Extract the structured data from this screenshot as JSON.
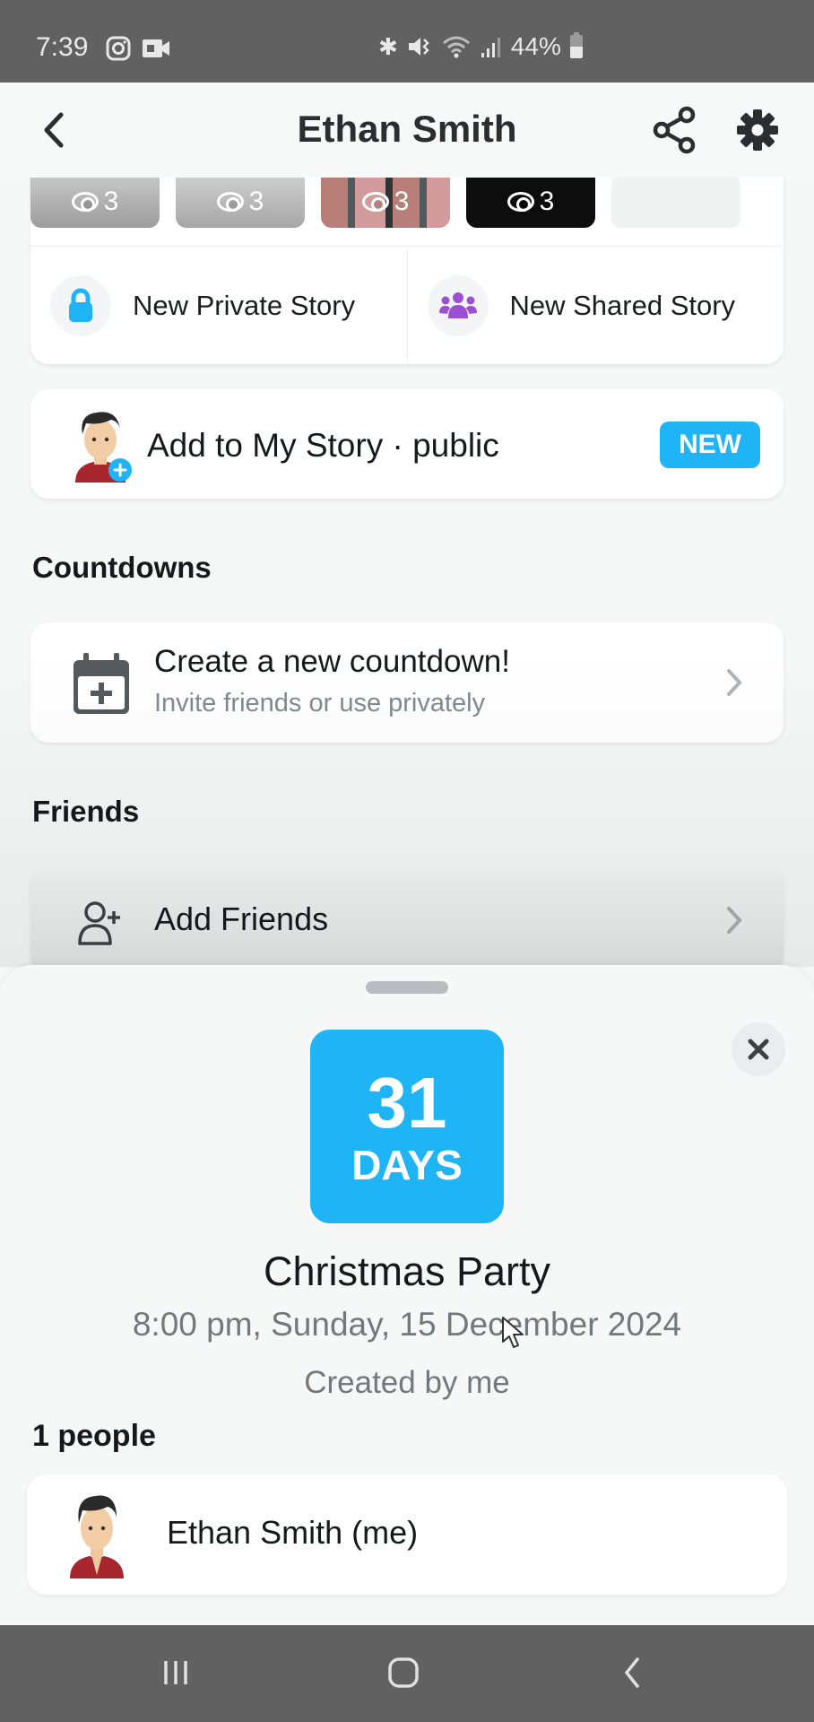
{
  "status_bar": {
    "time": "7:39",
    "left_icons": [
      "instagram-icon",
      "video-camera-icon"
    ],
    "right_icons": [
      "bluetooth-icon",
      "vibrate-mute-icon",
      "wifi-icon",
      "signal-icon"
    ],
    "battery_percent": "44%",
    "battery_level": 0.44
  },
  "header": {
    "title": "Ethan Smith",
    "back_icon": "chevron-left-icon",
    "share_icon": "share-icon",
    "settings_icon": "gear-icon"
  },
  "stories": {
    "thumbnails": [
      {
        "views": "3"
      },
      {
        "views": "3"
      },
      {
        "views": "3"
      },
      {
        "views": "3"
      },
      {
        "views": ""
      }
    ],
    "actions": [
      {
        "label": "New Private Story",
        "icon": "lock-icon",
        "color": "#1fb4f5"
      },
      {
        "label": "New Shared Story",
        "icon": "group-icon",
        "color": "#9b4fd1"
      }
    ]
  },
  "my_story": {
    "label": "Add to My Story · public",
    "badge": "NEW",
    "badge_color": "#1fb4f5"
  },
  "countdowns": {
    "section_title": "Countdowns",
    "create_title": "Create a new countdown!",
    "create_subtitle": "Invite friends or use privately"
  },
  "friends": {
    "section_title": "Friends",
    "add_friends_label": "Add Friends"
  },
  "countdown_sheet": {
    "days_number": "31",
    "days_unit": "DAYS",
    "event_title": "Christmas Party",
    "event_datetime": "8:00 pm, Sunday, 15 December 2024",
    "creator": "Created by me",
    "people_count": "1 people",
    "members": [
      {
        "name": "Ethan Smith (me)"
      }
    ],
    "accent_color": "#1fb4f5"
  },
  "nav_bar": {
    "buttons": [
      "recent-apps-icon",
      "home-icon",
      "back-icon"
    ]
  }
}
